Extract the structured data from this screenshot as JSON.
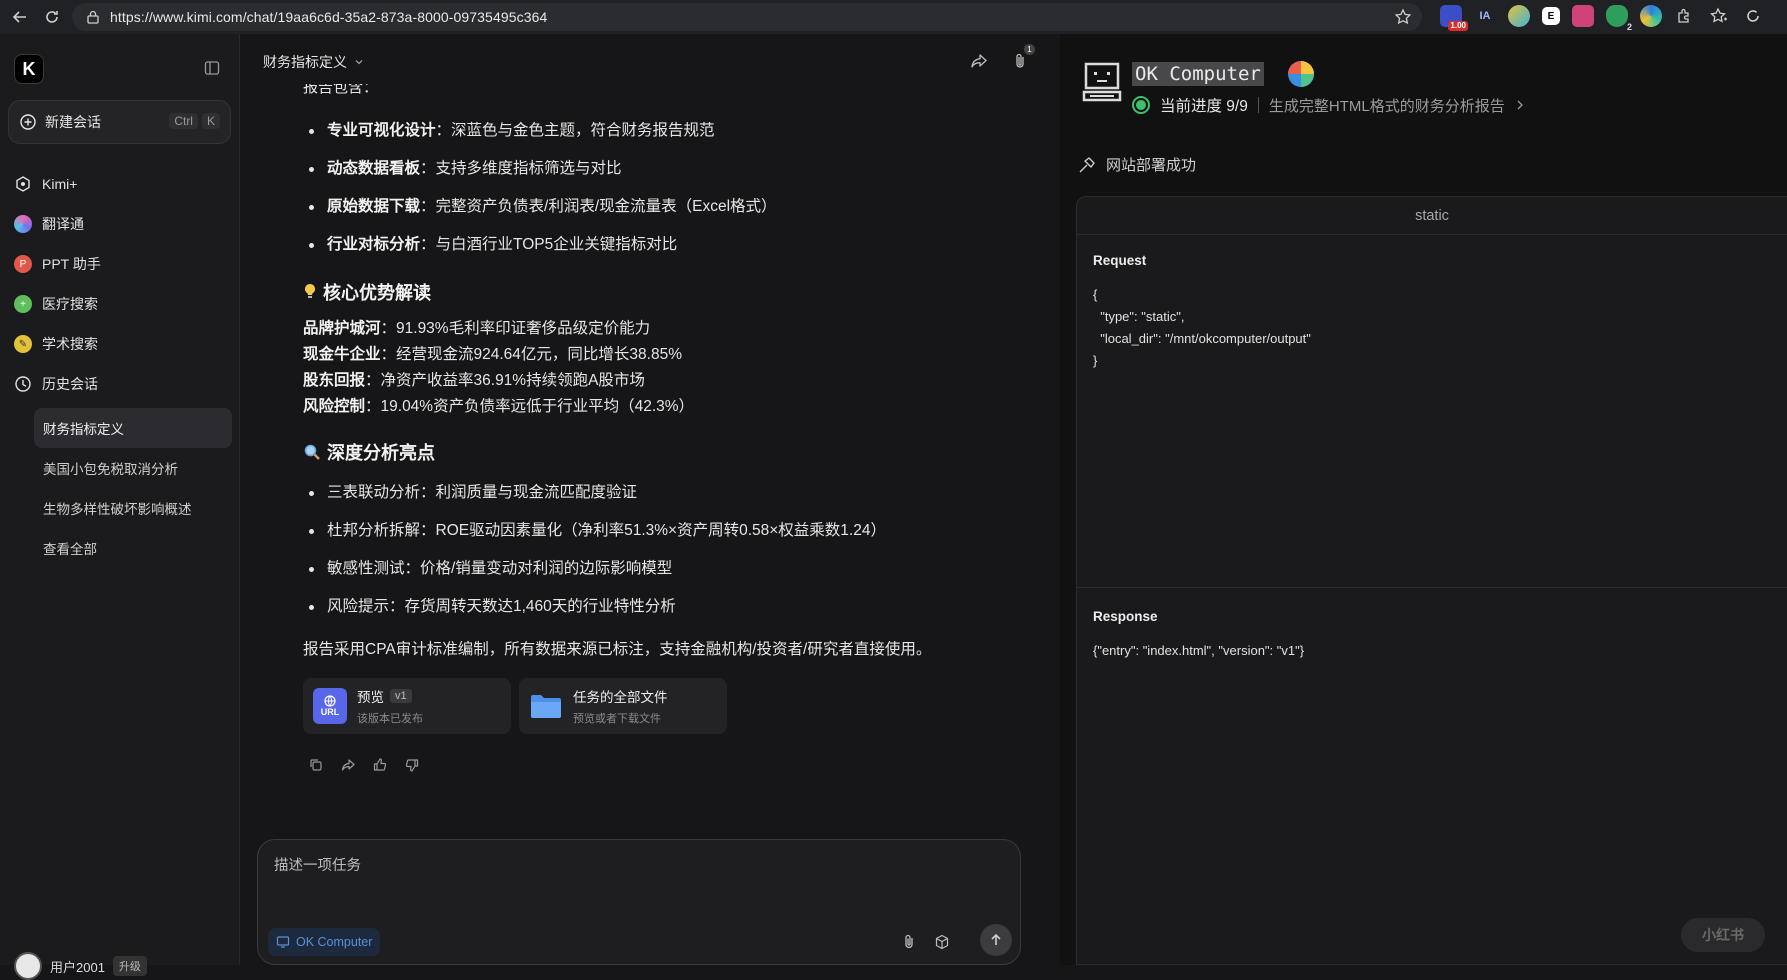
{
  "browser": {
    "url": "https://www.kimi.com/chat/19aa6c6d-35a2-873a-8000-09735495c364",
    "ext_badge": "1.00",
    "ext_ia": "IA",
    "ext_e": "E",
    "ext_num": "2"
  },
  "sidebar": {
    "logo": "K",
    "new_chat": {
      "label": "新建会话",
      "shortcut": [
        "Ctrl",
        "K"
      ]
    },
    "items": [
      {
        "label": "Kimi+",
        "icon": "kimi-plus-icon",
        "color": "#555555"
      },
      {
        "label": "翻译通",
        "icon": "translate-icon",
        "color": "#c86fe0"
      },
      {
        "label": "PPT 助手",
        "icon": "ppt-icon",
        "color": "#e0574b"
      },
      {
        "label": "医疗搜索",
        "icon": "medical-search-icon",
        "color": "#5fbf5a"
      },
      {
        "label": "学术搜索",
        "icon": "academic-search-icon",
        "color": "#e3c23b"
      }
    ],
    "history_label": "历史会话",
    "history": [
      {
        "label": "财务指标定义",
        "active": true
      },
      {
        "label": "美国小包免税取消分析",
        "active": false
      },
      {
        "label": "生物多样性破坏影响概述",
        "active": false
      },
      {
        "label": "查看全部",
        "active": false
      }
    ],
    "user": {
      "name": "用户2001",
      "tag": "升级"
    }
  },
  "chat": {
    "title": "财务指标定义",
    "clip_count": "1",
    "cut_line": "报告包含：",
    "features": [
      {
        "bold": "专业可视化设计",
        "text": "：深蓝色与金色主题，符合财务报告规范"
      },
      {
        "bold": "动态数据看板",
        "text": "：支持多维度指标筛选与对比"
      },
      {
        "bold": "原始数据下载",
        "text": "：完整资产负债表/利润表/现金流量表（Excel格式）"
      },
      {
        "bold": "行业对标分析",
        "text": "：与白酒行业TOP5企业关键指标对比"
      }
    ],
    "advantages_title": "核心优势解读",
    "advantages": [
      {
        "bold": "品牌护城河",
        "text": "：91.93%毛利率印证奢侈品级定价能力"
      },
      {
        "bold": "现金牛企业",
        "text": "：经营现金流924.64亿元，同比增长38.85%"
      },
      {
        "bold": "股东回报",
        "text": "：净资产收益率36.91%持续领跑A股市场"
      },
      {
        "bold": "风险控制",
        "text": "：19.04%资产负债率远低于行业平均（42.3%）"
      }
    ],
    "highlights_title": "深度分析亮点",
    "highlights": [
      "三表联动分析：利润质量与现金流匹配度验证",
      "杜邦分析拆解：ROE驱动因素量化（净利率51.3%×资产周转0.58×权益乘数1.24）",
      "敏感性测试：价格/销量变动对利润的边际影响模型",
      "风险提示：存货周转天数达1,460天的行业特性分析"
    ],
    "summary": "报告采用CPA审计标准编制，所有数据来源已标注，支持金融机构/投资者/研究者直接使用。",
    "cards": [
      {
        "title": "预览",
        "tag": "v1",
        "sub": "该版本已发布",
        "icon_text": "URL",
        "color": "#5866e8"
      },
      {
        "title": "任务的全部文件",
        "tag": "",
        "sub": "预览或者下载文件",
        "icon_text": "",
        "color": "#4f8fe8"
      }
    ],
    "input": {
      "placeholder": "描述一项任务",
      "chip": "OK Computer"
    }
  },
  "panel": {
    "title": "OK Computer",
    "progress": "当前进度 9/9",
    "task": "生成完整HTML格式的财务分析报告",
    "deploy": "网站部署成功",
    "log_header": "static",
    "request_label": "Request",
    "request_body": "{\n  \"type\": \"static\",\n  \"local_dir\": \"/mnt/okcomputer/output\"\n}",
    "response_label": "Response",
    "response_body": "{\"entry\": \"index.html\", \"version\": \"v1\"}",
    "watermark": "小红书"
  }
}
